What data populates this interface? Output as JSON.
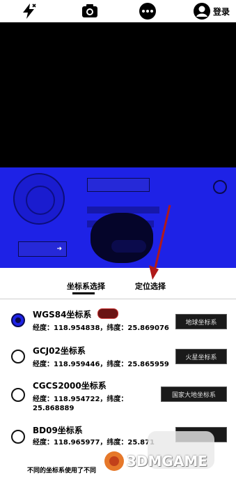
{
  "topbar": {
    "login_label": "登录",
    "icons": [
      "bolt-icon",
      "camera-icon",
      "more-icon",
      "user-icon"
    ]
  },
  "tabs": [
    {
      "label": "坐标系选择",
      "active": true
    },
    {
      "label": "定位选择",
      "active": false
    }
  ],
  "coordinate_systems": [
    {
      "name": "WGS84坐标系",
      "values": "经度：118.954838，纬度：25.869076",
      "button": "地球坐标系",
      "selected": true
    },
    {
      "name": "GCJ02坐标系",
      "values": "经度：118.959446，纬度：25.865959",
      "button": "火星坐标系",
      "selected": false
    },
    {
      "name": "CGCS2000坐标系",
      "values_line1": "经度：118.954722，纬度：",
      "values_line2": "25.868889",
      "button": "国家大地坐标系",
      "selected": false
    },
    {
      "name": "BD09坐标系",
      "values": "经度：118.965977，纬度：25.871",
      "button": "",
      "selected": false
    }
  ],
  "footer": {
    "text": "不同的坐标系使用了不同"
  },
  "watermark": {
    "text": "3DMGAME"
  },
  "colors": {
    "panel_blue": "#1e22e6",
    "arrow_red": "#b01a1a",
    "preview_black": "#000000"
  }
}
